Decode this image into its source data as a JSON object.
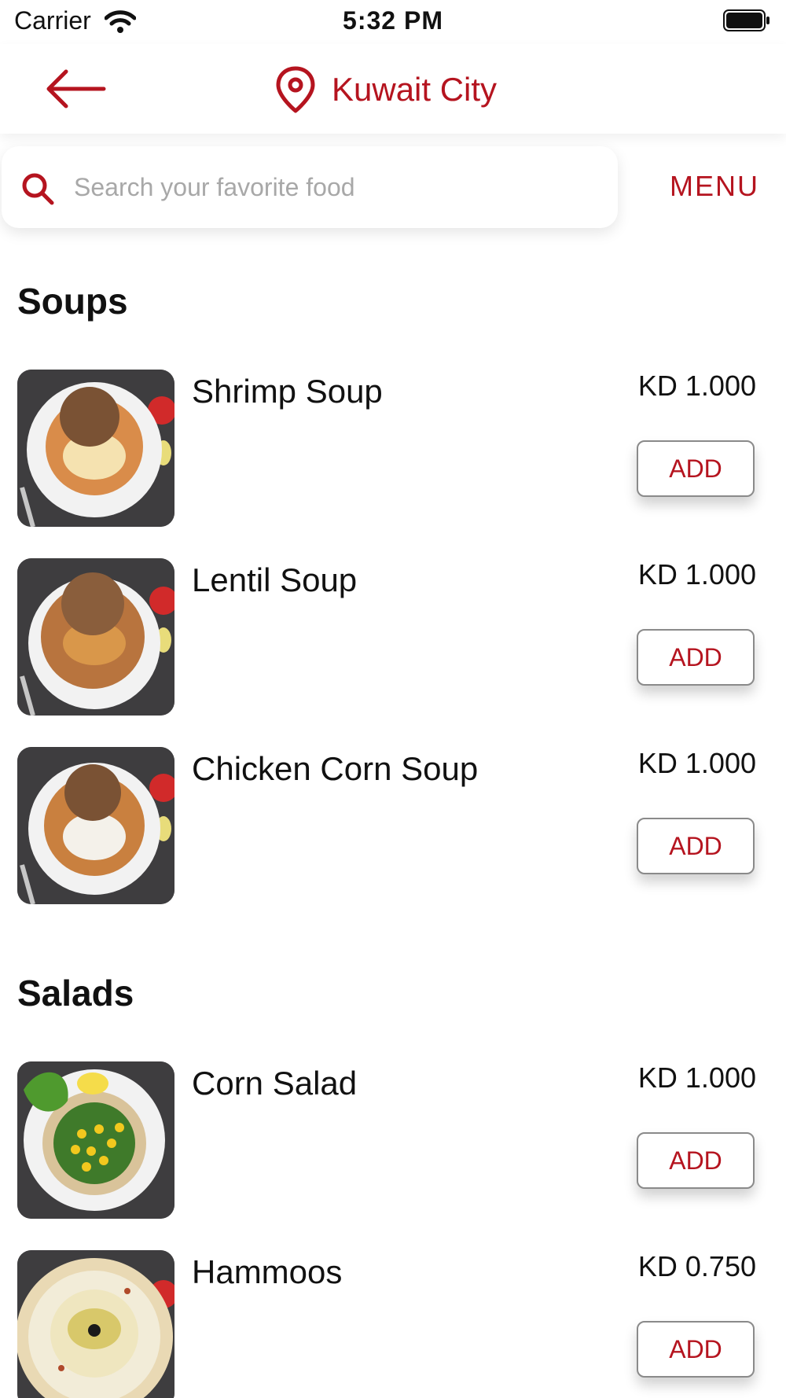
{
  "status_bar": {
    "carrier": "Carrier",
    "time": "5:32 PM",
    "icons": [
      "wifi-icon",
      "battery-icon"
    ]
  },
  "header": {
    "back_icon": "arrow-left-icon",
    "location_icon": "map-pin-icon",
    "location": "Kuwait City"
  },
  "search": {
    "placeholder": "Search your favorite food",
    "value": "",
    "icon": "search-icon",
    "menu_label": "MENU"
  },
  "sections": [
    {
      "title": "Soups",
      "items": [
        {
          "name": "Shrimp Soup",
          "price": "KD 1.000",
          "add_label": "ADD"
        },
        {
          "name": "Lentil Soup",
          "price": "KD 1.000",
          "add_label": "ADD"
        },
        {
          "name": "Chicken Corn Soup",
          "price": "KD 1.000",
          "add_label": "ADD"
        }
      ]
    },
    {
      "title": "Salads",
      "items": [
        {
          "name": "Corn Salad",
          "price": "KD 1.000",
          "add_label": "ADD"
        },
        {
          "name": "Hammoos",
          "price": "KD 0.750",
          "add_label": "ADD"
        }
      ]
    }
  ],
  "colors": {
    "accent": "#b5141f",
    "text": "#111111",
    "placeholder": "#a8a8a8",
    "button_border": "#8a8a8a"
  }
}
